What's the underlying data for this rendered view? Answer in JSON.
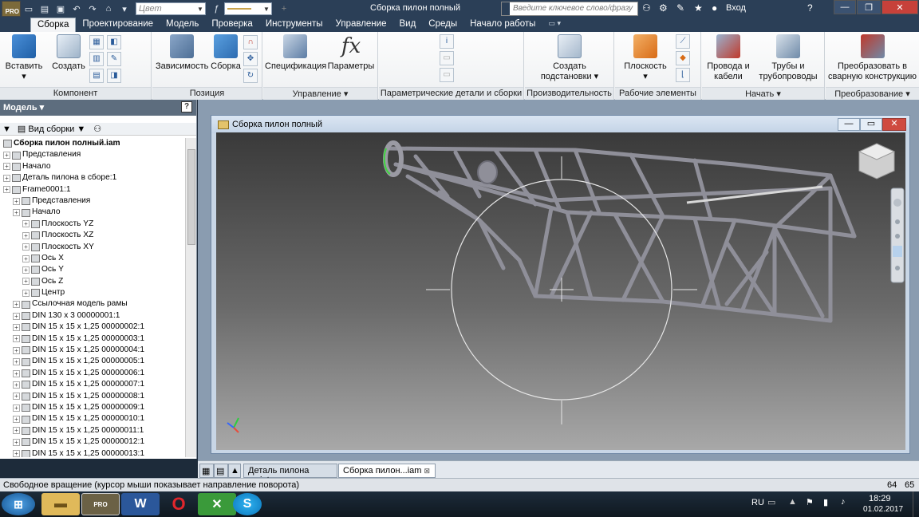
{
  "titlebar": {
    "document_title": "Сборка пилон полный",
    "color_combo": "Цвет",
    "search_placeholder": "Введите ключевое слово/фразу",
    "login": "Вход",
    "app_badge": "PRO"
  },
  "ribbon_tabs": [
    "Сборка",
    "Проектирование",
    "Модель",
    "Проверка",
    "Инструменты",
    "Управление",
    "Вид",
    "Среды",
    "Начало работы"
  ],
  "ribbon": {
    "komponent": {
      "label": "Компонент",
      "insert": "Вставить",
      "create": "Создать"
    },
    "pozitsiya": {
      "label": "Позиция",
      "dependency": "Зависимость",
      "assembly": "Сборка"
    },
    "upravlenie": {
      "label": "Управление",
      "specs": "Спецификация",
      "params": "Параметры"
    },
    "param": {
      "label": "Параметрические детали и сборки"
    },
    "production": {
      "label": "Производительность",
      "create_subst_1": "Создать",
      "create_subst_2": "подстановки"
    },
    "work": {
      "label": "Рабочие элементы",
      "plane": "Плоскость"
    },
    "start": {
      "label": "Начать",
      "wires_1": "Провода и",
      "wires_2": "кабели",
      "pipes_1": "Трубы и",
      "pipes_2": "трубопроводы"
    },
    "convert": {
      "label": "Преобразование",
      "conv_1": "Преобразовать в",
      "conv_2": "сварную конструкцию"
    }
  },
  "browser": {
    "title": "Модель",
    "view": "Вид сборки",
    "help": "?"
  },
  "tree": [
    {
      "label": "Сборка пилон полный.iam",
      "indent": 0,
      "bold": true
    },
    {
      "label": "Представления",
      "indent": 0
    },
    {
      "label": "Начало",
      "indent": 0
    },
    {
      "label": "Деталь пилона в сборе:1",
      "indent": 0
    },
    {
      "label": "Frame0001:1",
      "indent": 0
    },
    {
      "label": "Представления",
      "indent": 1
    },
    {
      "label": "Начало",
      "indent": 1
    },
    {
      "label": "Плоскость YZ",
      "indent": 2
    },
    {
      "label": "Плоскость XZ",
      "indent": 2
    },
    {
      "label": "Плоскость XY",
      "indent": 2
    },
    {
      "label": "Ось X",
      "indent": 2
    },
    {
      "label": "Ось Y",
      "indent": 2
    },
    {
      "label": "Ось Z",
      "indent": 2
    },
    {
      "label": "Центр",
      "indent": 2
    },
    {
      "label": "Ссылочная модель рамы",
      "indent": 1
    },
    {
      "label": "DIN 130 x 3 00000001:1",
      "indent": 1
    },
    {
      "label": "DIN 15 x 15 x 1,25 00000002:1",
      "indent": 1
    },
    {
      "label": "DIN 15 x 15 x 1,25 00000003:1",
      "indent": 1
    },
    {
      "label": "DIN 15 x 15 x 1,25 00000004:1",
      "indent": 1
    },
    {
      "label": "DIN 15 x 15 x 1,25 00000005:1",
      "indent": 1
    },
    {
      "label": "DIN 15 x 15 x 1,25 00000006:1",
      "indent": 1
    },
    {
      "label": "DIN 15 x 15 x 1,25 00000007:1",
      "indent": 1
    },
    {
      "label": "DIN 15 x 15 x 1,25 00000008:1",
      "indent": 1
    },
    {
      "label": "DIN 15 x 15 x 1,25 00000009:1",
      "indent": 1
    },
    {
      "label": "DIN 15 x 15 x 1,25 00000010:1",
      "indent": 1
    },
    {
      "label": "DIN 15 x 15 x 1,25 00000011:1",
      "indent": 1
    },
    {
      "label": "DIN 15 x 15 x 1,25 00000012:1",
      "indent": 1
    },
    {
      "label": "DIN 15 x 15 x 1,25 00000013:1",
      "indent": 1
    }
  ],
  "docwindow": {
    "title": "Сборка пилон полный"
  },
  "doctabs": {
    "tab1": "Деталь пилона в...ipt",
    "tab2": "Сборка пилон...iam"
  },
  "status": {
    "text": "Свободное вращение (курсор мыши показывает направление поворота)",
    "num1": "64",
    "num2": "65"
  },
  "taskbar": {
    "lang": "RU",
    "time": "18:29",
    "date": "01.02.2017"
  },
  "colors": {
    "title_bg": "#2b3f57",
    "accent_green": "#3fd43f"
  }
}
